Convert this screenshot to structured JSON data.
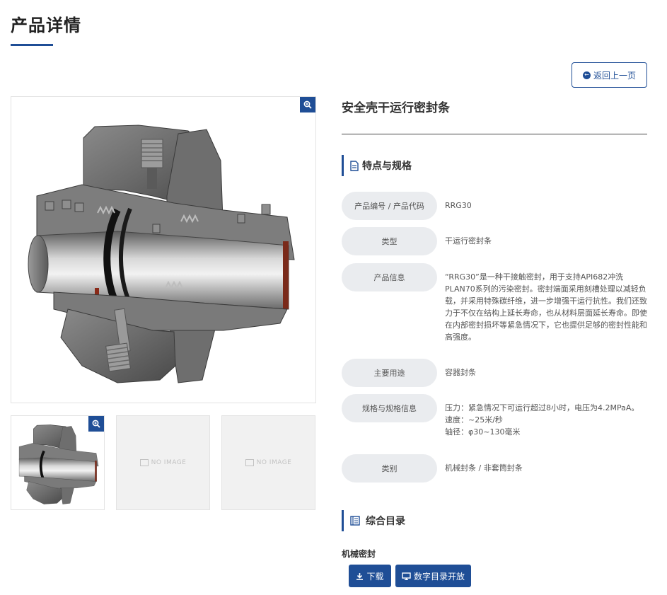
{
  "header": {
    "title": "产品详情"
  },
  "back_button": {
    "label": "返回上一页",
    "icon": "arrow-left-circle-icon"
  },
  "gallery": {
    "main_zoom_icon": "zoom-in-icon",
    "thumbs": [
      {
        "type": "image"
      },
      {
        "type": "placeholder",
        "label": "NO IMAGE"
      },
      {
        "type": "placeholder",
        "label": "NO IMAGE"
      }
    ]
  },
  "product": {
    "name": "安全壳干运行密封条"
  },
  "features": {
    "heading": "特点与规格",
    "icon": "document-icon",
    "rows": [
      {
        "label": "产品编号 / 产品代码",
        "value": "RRG30"
      },
      {
        "label": "类型",
        "value": "干运行密封条"
      },
      {
        "label": "产品信息",
        "value": "“RRG30”是一种干接触密封，用于支持API682冲洗PLAN70系列的污染密封。密封端面采用刻槽处理以减轻负载，并采用特殊碳纤维，进一步增强干运行抗性。我们还致力于不仅在结构上延长寿命，也从材料层面延长寿命。即使在内部密封损坏等紧急情况下，它也提供足够的密封性能和高强度。"
      },
      {
        "label": "主要用途",
        "value": "容器封条"
      },
      {
        "label": "规格与规格信息",
        "value": "压力：紧急情况下可运行超过8小时，电压为4.2MPaA。\n速度：~25米/秒\n轴径：φ30~130毫米"
      },
      {
        "label": "类别",
        "value": "机械封条 / 非套筒封条"
      }
    ]
  },
  "catalog": {
    "heading": "综合目录",
    "icon": "book-icon",
    "item_title": "机械密封",
    "download_label": "下载",
    "download_icon": "download-icon",
    "digital_label": "数字目录开放",
    "digital_icon": "monitor-icon"
  },
  "colors": {
    "accent": "#1f4e96",
    "label_bg": "#eaecef"
  }
}
